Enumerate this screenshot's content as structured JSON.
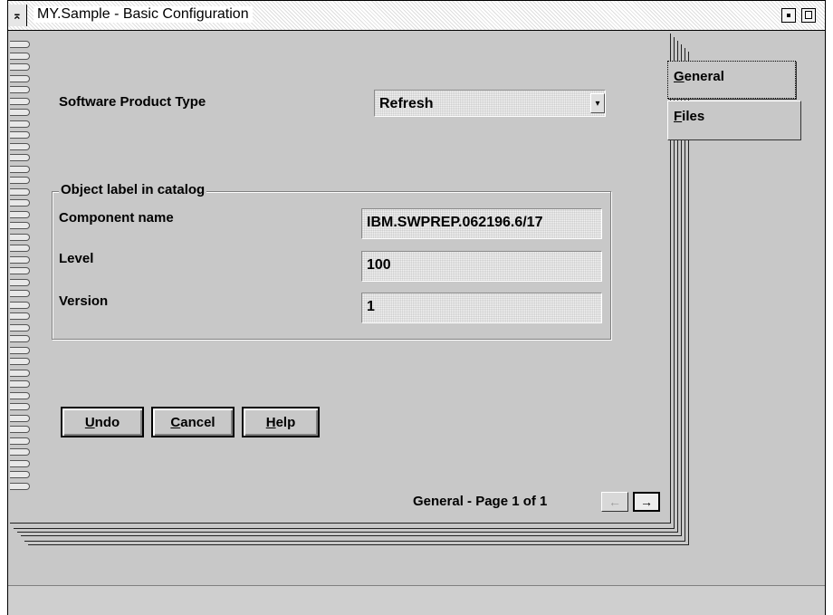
{
  "window": {
    "title": "MY.Sample - Basic Configuration",
    "system_menu_glyph": "⌅",
    "minimize_icon": "minimize-icon",
    "maximize_icon": "maximize-icon"
  },
  "form": {
    "product_type_label": "Software Product Type",
    "product_type_value": "Refresh",
    "dropdown_glyph": "▾",
    "group_title": "Object label in catalog",
    "component_name_label": "Component name",
    "component_name_value": "IBM.SWPREP.062196.6/17",
    "level_label": "Level",
    "level_value": "100",
    "version_label": "Version",
    "version_value": "1"
  },
  "buttons": {
    "undo_mnemonic": "U",
    "undo_rest": "ndo",
    "cancel_mnemonic": "C",
    "cancel_rest": "ancel",
    "help_mnemonic": "H",
    "help_rest": "elp"
  },
  "tabs": [
    {
      "mnemonic": "G",
      "rest": "eneral",
      "active": true
    },
    {
      "mnemonic": "F",
      "rest": "iles",
      "active": false
    }
  ],
  "pager": {
    "text": "General  -  Page 1 of 1",
    "prev_glyph": "←",
    "next_glyph": "→"
  },
  "colors": {
    "background": "#c8c8c8",
    "text": "#000000"
  }
}
